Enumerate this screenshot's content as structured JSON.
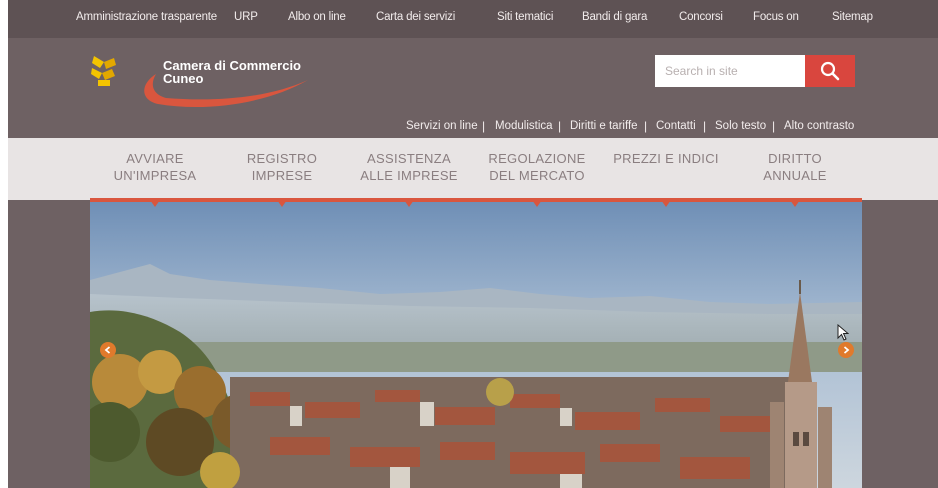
{
  "topbar": {
    "links": [
      "Amministrazione trasparente",
      "URP",
      "Albo on line",
      "Carta dei servizi",
      "Siti tematici",
      "Bandi di gara",
      "Concorsi",
      "Focus on",
      "Sitemap"
    ]
  },
  "logo": {
    "line1": "Camera di Commercio",
    "line2": "Cuneo"
  },
  "search": {
    "placeholder": "Search in site"
  },
  "secondary_links": [
    "Servizi on line",
    "Modulistica",
    "Diritti e tariffe",
    "Contatti",
    "Solo testo",
    "Alto contrasto"
  ],
  "main_nav": [
    {
      "line1": "AVVIARE",
      "line2": "UN'IMPRESA"
    },
    {
      "line1": "REGISTRO",
      "line2": "IMPRESE"
    },
    {
      "line1": "ASSISTENZA",
      "line2": "ALLE IMPRESE"
    },
    {
      "line1": "REGOLAZIONE",
      "line2": "DEL MERCATO"
    },
    {
      "line1": "PREZZI E INDICI",
      "line2": ""
    },
    {
      "line1": "DIRITTO",
      "line2": "ANNUALE"
    }
  ],
  "colors": {
    "accent": "#d9463e",
    "background": "#6e6163",
    "nav_background": "#e8e4e4",
    "arrow": "#e07a2c"
  },
  "icons": {
    "search": "search-icon",
    "prev": "arrow-left-icon",
    "next": "arrow-right-icon",
    "logo": "chamber-of-commerce-logo-icon"
  }
}
